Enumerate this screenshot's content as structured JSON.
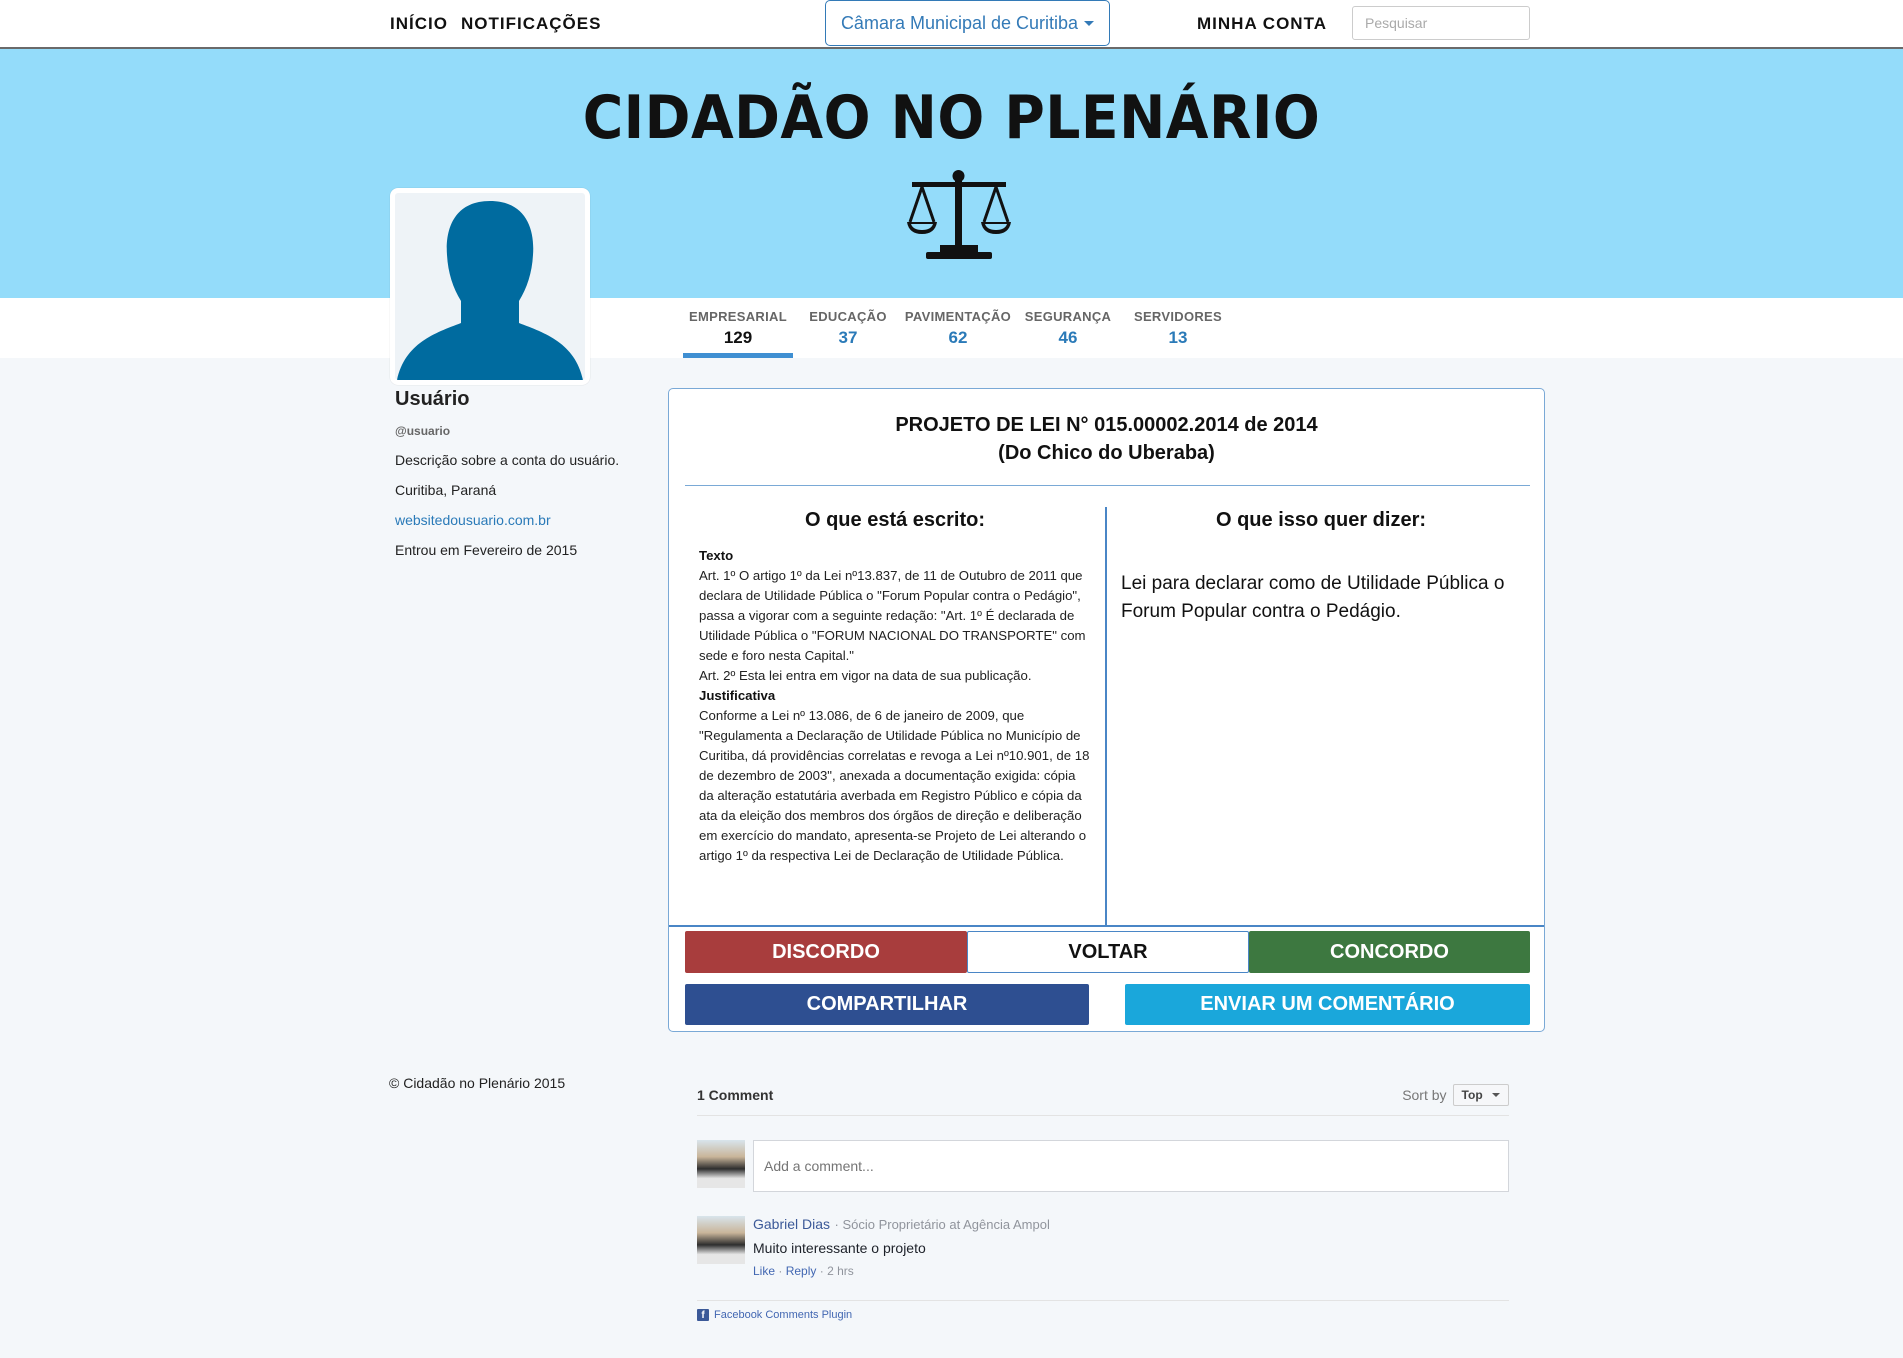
{
  "nav": {
    "home": "INÍCIO",
    "notifications": "NOTIFICAÇÕES",
    "dropdown_label": "Câmara Municipal de Curitiba",
    "account": "MINHA CONTA",
    "search_placeholder": "Pesquisar"
  },
  "hero": {
    "title": "CIDADÃO NO PLENÁRIO",
    "icon": "scale-of-justice-icon"
  },
  "stats": [
    {
      "label": "EMPRESARIAL",
      "count": "129",
      "active": true
    },
    {
      "label": "EDUCAÇÃO",
      "count": "37"
    },
    {
      "label": "PAVIMENTAÇÃO",
      "count": "62"
    },
    {
      "label": "SEGURANÇA",
      "count": "46"
    },
    {
      "label": "SERVIDORES",
      "count": "13"
    }
  ],
  "profile": {
    "name": "Usuário",
    "handle": "@usuario",
    "description": "Descrição sobre a conta do usuário.",
    "location": "Curitiba, Paraná",
    "website": "websitedousuario.com.br",
    "joined": "Entrou em Fevereiro de 2015"
  },
  "bill": {
    "title": "PROJETO DE LEI N° 015.00002.2014 de 2014",
    "author": "(Do Chico do Uberaba)",
    "written_header": "O que está escrito:",
    "meaning_header": "O que isso quer dizer:",
    "text_label": "Texto",
    "text_body": "Art. 1º O artigo 1º da Lei nº13.837, de 11 de Outubro de 2011 que declara de Utilidade Pública o \"Forum Popular contra o Pedágio\", passa a vigorar com a seguinte redação: \"Art. 1º É declarada de Utilidade Pública o \"FORUM NACIONAL DO TRANSPORTE\" com sede e foro nesta Capital.\"",
    "text_body2": "Art. 2º Esta lei entra em vigor na data de sua publicação.",
    "justification_label": "Justificativa",
    "justification_body": "Conforme a Lei nº 13.086, de 6 de janeiro de 2009, que \"Regulamenta a Declaração de Utilidade Pública no Município de Curitiba, dá providências correlatas e revoga a Lei nº10.901, de 18 de dezembro de 2003\", anexada a documentação exigida: cópia da alteração estatutária averbada em Registro Público e cópia da ata da eleição dos membros dos órgãos de direção e deliberação em exercício do mandato, apresenta-se Projeto de Lei alterando o artigo 1º da respectiva Lei de Declaração de Utilidade Pública.",
    "meaning": "Lei para declarar como de Utilidade Pública o Forum Popular contra o Pedágio."
  },
  "buttons": {
    "disagree": "DISCORDO",
    "back": "VOLTAR",
    "agree": "CONCORDO",
    "share": "COMPARTILHAR",
    "comment": "ENVIAR UM COMENTÁRIO"
  },
  "footer": "© Cidadão no Plenário 2015",
  "comments": {
    "count": "1 Comment",
    "sort_label": "Sort by",
    "sort_value": "Top",
    "placeholder": "Add a comment...",
    "items": [
      {
        "author": "Gabriel Dias",
        "role": "Sócio Proprietário at Agência Ampol",
        "text": "Muito interessante o projeto",
        "like": "Like",
        "reply": "Reply",
        "time": "2 hrs"
      }
    ],
    "plugin_label": "Facebook Comments Plugin"
  },
  "colors": {
    "hero_bg": "#94dcfa",
    "accent": "#337ab7",
    "disagree": "#a83d3d",
    "agree": "#3d7840",
    "share": "#2e4f91",
    "comment": "#1aa7db"
  }
}
